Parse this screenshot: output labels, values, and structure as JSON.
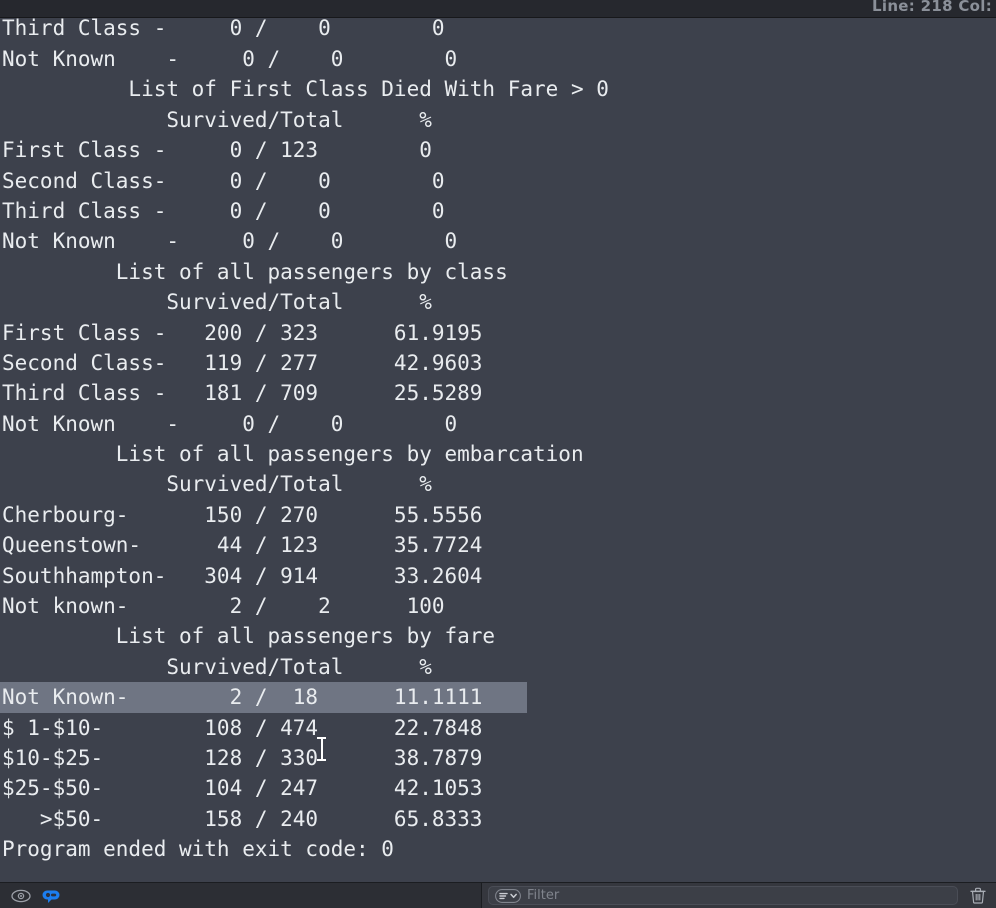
{
  "status_bar": {
    "line_col": "Line: 218  Col:"
  },
  "console": {
    "lines": [
      {
        "text": "Third Class -     0 /    0        0",
        "selected": false,
        "partial": true
      },
      {
        "text": "Not Known    -     0 /    0        0",
        "selected": false
      },
      {
        "text": "          List of First Class Died With Fare > 0",
        "selected": false
      },
      {
        "text": "             Survived/Total      %",
        "selected": false
      },
      {
        "text": "First Class -     0 / 123        0",
        "selected": false
      },
      {
        "text": "Second Class-     0 /    0        0",
        "selected": false
      },
      {
        "text": "Third Class -     0 /    0        0",
        "selected": false
      },
      {
        "text": "Not Known    -     0 /    0        0",
        "selected": false
      },
      {
        "text": "         List of all passengers by class",
        "selected": false
      },
      {
        "text": "             Survived/Total      %",
        "selected": false
      },
      {
        "text": "First Class -   200 / 323      61.9195",
        "selected": false
      },
      {
        "text": "Second Class-   119 / 277      42.9603",
        "selected": false
      },
      {
        "text": "Third Class -   181 / 709      25.5289",
        "selected": false
      },
      {
        "text": "Not Known    -     0 /    0        0",
        "selected": false
      },
      {
        "text": "         List of all passengers by embarcation",
        "selected": false
      },
      {
        "text": "             Survived/Total      %",
        "selected": false
      },
      {
        "text": "Cherbourg-      150 / 270      55.5556",
        "selected": false
      },
      {
        "text": "Queenstown-      44 / 123      35.7724",
        "selected": false
      },
      {
        "text": "Southhampton-   304 / 914      33.2604",
        "selected": false
      },
      {
        "text": "Not known-        2 /    2      100",
        "selected": false
      },
      {
        "text": "         List of all passengers by fare",
        "selected": false
      },
      {
        "text": "             Survived/Total      %",
        "selected": false
      },
      {
        "text": "Not Known-        2 /  18      11.1111",
        "selected": true
      },
      {
        "text": "$ 1-$10-        108 / 474      22.7848",
        "selected": false
      },
      {
        "text": "$10-$25-        128 / 330      38.7879",
        "selected": false
      },
      {
        "text": "$25-$50-        104 / 247      42.1053",
        "selected": false
      },
      {
        "text": "   >$50-        158 / 240      65.8333",
        "selected": false
      },
      {
        "text": "Program ended with exit code: 0",
        "selected": false
      }
    ]
  },
  "tables": {
    "first_class_died_with_fare": {
      "title": "List of First Class Died With Fare > 0",
      "columns": [
        "",
        "Survived/Total",
        "%"
      ],
      "rows": [
        {
          "label": "First Class -",
          "survived": 0,
          "total": 123,
          "percent": "0"
        },
        {
          "label": "Second Class-",
          "survived": 0,
          "total": 0,
          "percent": "0"
        },
        {
          "label": "Third Class -",
          "survived": 0,
          "total": 0,
          "percent": "0"
        },
        {
          "label": "Not Known    -",
          "survived": 0,
          "total": 0,
          "percent": "0"
        }
      ]
    },
    "by_class": {
      "title": "List of all passengers by class",
      "columns": [
        "",
        "Survived/Total",
        "%"
      ],
      "rows": [
        {
          "label": "First Class -",
          "survived": 200,
          "total": 323,
          "percent": "61.9195"
        },
        {
          "label": "Second Class-",
          "survived": 119,
          "total": 277,
          "percent": "42.9603"
        },
        {
          "label": "Third Class -",
          "survived": 181,
          "total": 709,
          "percent": "25.5289"
        },
        {
          "label": "Not Known    -",
          "survived": 0,
          "total": 0,
          "percent": "0"
        }
      ]
    },
    "by_embarcation": {
      "title": "List of all passengers by embarcation",
      "columns": [
        "",
        "Survived/Total",
        "%"
      ],
      "rows": [
        {
          "label": "Cherbourg-",
          "survived": 150,
          "total": 270,
          "percent": "55.5556"
        },
        {
          "label": "Queenstown-",
          "survived": 44,
          "total": 123,
          "percent": "35.7724"
        },
        {
          "label": "Southhampton-",
          "survived": 304,
          "total": 914,
          "percent": "33.2604"
        },
        {
          "label": "Not known-",
          "survived": 2,
          "total": 2,
          "percent": "100"
        }
      ]
    },
    "by_fare": {
      "title": "List of all passengers by fare",
      "columns": [
        "",
        "Survived/Total",
        "%"
      ],
      "rows": [
        {
          "label": "Not Known-",
          "survived": 2,
          "total": 18,
          "percent": "11.1111"
        },
        {
          "label": "$ 1-$10-",
          "survived": 108,
          "total": 474,
          "percent": "22.7848"
        },
        {
          "label": "$10-$25-",
          "survived": 128,
          "total": 330,
          "percent": "38.7879"
        },
        {
          "label": "$25-$50-",
          "survived": 104,
          "total": 247,
          "percent": "42.1053"
        },
        {
          "label": "   >$50-",
          "survived": 158,
          "total": 240,
          "percent": "65.8333"
        }
      ]
    }
  },
  "exit_message": "Program ended with exit code: 0",
  "toolbar": {
    "eye_icon": "eye-icon",
    "console_icon": "console-output-icon",
    "filter_icon": "filter-lines-icon",
    "filter_placeholder": "Filter",
    "trash_icon": "trash-icon"
  },
  "colors": {
    "background": "#3d414c",
    "text": "#e9ecef",
    "selection": "#6f7583",
    "status_bar": "#26282e",
    "toolbar": "#2c2e34",
    "accent_blue": "#1c7ef0"
  }
}
